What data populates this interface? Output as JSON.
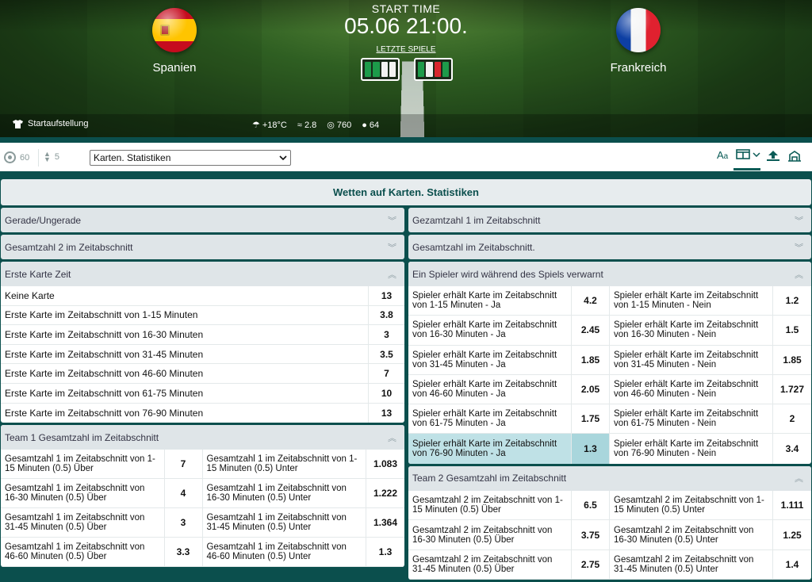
{
  "header": {
    "start_label": "START TIME",
    "start_time": "05.06 21:00.",
    "last_games_label": "LETZTE SPIELE",
    "team_home": "Spanien",
    "team_away": "Frankreich",
    "home_flag": "spain-flag-icon",
    "away_flag": "france-flag-icon",
    "home_form": [
      "#1d9b4a",
      "#1d9b4a",
      "#f2f2f2",
      "#f2f2f2"
    ],
    "away_form": [
      "#1d9b4a",
      "#f2f2f2",
      "#d8262e",
      "#1d9b4a"
    ],
    "lineup_label": "Startaufstellung",
    "temperature": "+18°C",
    "wind": "2.8",
    "pressure": "760",
    "humidity": "64"
  },
  "toolbar": {
    "markets_count": "60",
    "updown_count": "5",
    "select_value": "Karten. Statistiken"
  },
  "section_title": "Wetten auf Karten. Statistiken",
  "left_groups": {
    "g1": "Gerade/Ungerade",
    "g2": "Gesamtzahl 2 im Zeitabschnitt",
    "g3": "Erste Karte Zeit",
    "g3_rows": [
      {
        "label": "Keine Karte",
        "odd": "13"
      },
      {
        "label": "Erste Karte im Zeitabschnitt von 1-15 Minuten",
        "odd": "3.8"
      },
      {
        "label": "Erste Karte im Zeitabschnitt von 16-30 Minuten",
        "odd": "3"
      },
      {
        "label": "Erste Karte im Zeitabschnitt von 31-45 Minuten",
        "odd": "3.5"
      },
      {
        "label": "Erste Karte im Zeitabschnitt von 46-60 Minuten",
        "odd": "7"
      },
      {
        "label": "Erste Karte im Zeitabschnitt von 61-75 Minuten",
        "odd": "10"
      },
      {
        "label": "Erste Karte im Zeitabschnitt von 76-90 Minuten",
        "odd": "13"
      }
    ],
    "g4": "Team 1 Gesamtzahl im Zeitabschnitt",
    "g4_rows": [
      {
        "a": "Gesamtzahl 1 im Zeitabschnitt von 1-15 Minuten (0.5) Über",
        "ao": "7",
        "b": "Gesamtzahl 1 im Zeitabschnitt von 1-15 Minuten (0.5) Unter",
        "bo": "1.083"
      },
      {
        "a": "Gesamtzahl 1 im Zeitabschnitt von 16-30 Minuten (0.5) Über",
        "ao": "4",
        "b": "Gesamtzahl 1 im Zeitabschnitt von 16-30 Minuten (0.5) Unter",
        "bo": "1.222"
      },
      {
        "a": "Gesamtzahl 1 im Zeitabschnitt von 31-45 Minuten (0.5) Über",
        "ao": "3",
        "b": "Gesamtzahl 1 im Zeitabschnitt von 31-45 Minuten (0.5) Unter",
        "bo": "1.364"
      },
      {
        "a": "Gesamtzahl 1 im Zeitabschnitt von 46-60 Minuten (0.5) Über",
        "ao": "3.3",
        "b": "Gesamtzahl 1 im Zeitabschnitt von 46-60 Minuten (0.5) Unter",
        "bo": "1.3"
      }
    ]
  },
  "right_groups": {
    "g1": "Gezamtzahl 1 im Zeitabschnitt",
    "g2": "Gesamtzahl im Zeitabschnitt.",
    "g3": "Ein Spieler wird während des Spiels verwarnt",
    "g3_rows": [
      {
        "a": "Spieler erhält Karte im Zeitabschnitt von 1-15 Minuten - Ja",
        "ao": "4.2",
        "b": "Spieler erhält Karte im Zeitabschnitt von 1-15 Minuten - Nein",
        "bo": "1.2"
      },
      {
        "a": "Spieler erhält Karte im Zeitabschnitt von 16-30 Minuten - Ja",
        "ao": "2.45",
        "b": "Spieler erhält Karte im Zeitabschnitt von 16-30 Minuten - Nein",
        "bo": "1.5"
      },
      {
        "a": "Spieler erhält Karte im Zeitabschnitt von 31-45 Minuten - Ja",
        "ao": "1.85",
        "b": "Spieler erhält Karte im Zeitabschnitt von 31-45 Minuten - Nein",
        "bo": "1.85"
      },
      {
        "a": "Spieler erhält Karte im Zeitabschnitt von 46-60 Minuten - Ja",
        "ao": "2.05",
        "b": "Spieler erhält Karte im Zeitabschnitt von 46-60 Minuten - Nein",
        "bo": "1.727"
      },
      {
        "a": "Spieler erhält Karte im Zeitabschnitt von 61-75 Minuten - Ja",
        "ao": "1.75",
        "b": "Spieler erhält Karte im Zeitabschnitt von 61-75 Minuten - Nein",
        "bo": "2"
      },
      {
        "a": "Spieler erhält Karte im Zeitabschnitt von 76-90 Minuten - Ja",
        "ao": "1.3",
        "b": "Spieler erhält Karte im Zeitabschnitt von 76-90 Minuten - Nein",
        "bo": "3.4"
      }
    ],
    "g4": "Team 2 Gesamtzahl im Zeitabschnitt",
    "g4_rows": [
      {
        "a": "Gesamtzahl 2 im Zeitabschnitt von 1-15 Minuten (0.5) Über",
        "ao": "6.5",
        "b": "Gesamtzahl 2 im Zeitabschnitt von 1-15 Minuten (0.5) Unter",
        "bo": "1.111"
      },
      {
        "a": "Gesamtzahl 2 im Zeitabschnitt von 16-30 Minuten (0.5) Über",
        "ao": "3.75",
        "b": "Gesamtzahl 2 im Zeitabschnitt von 16-30 Minuten (0.5) Unter",
        "bo": "1.25"
      },
      {
        "a": "Gesamtzahl 2 im Zeitabschnitt von 31-45 Minuten (0.5) Über",
        "ao": "2.75",
        "b": "Gesamtzahl 2 im Zeitabschnitt von 31-45 Minuten (0.5) Unter",
        "bo": "1.4"
      }
    ]
  },
  "colors": {
    "accent": "#0b4f4d",
    "highlight": "#a9d6dc"
  }
}
